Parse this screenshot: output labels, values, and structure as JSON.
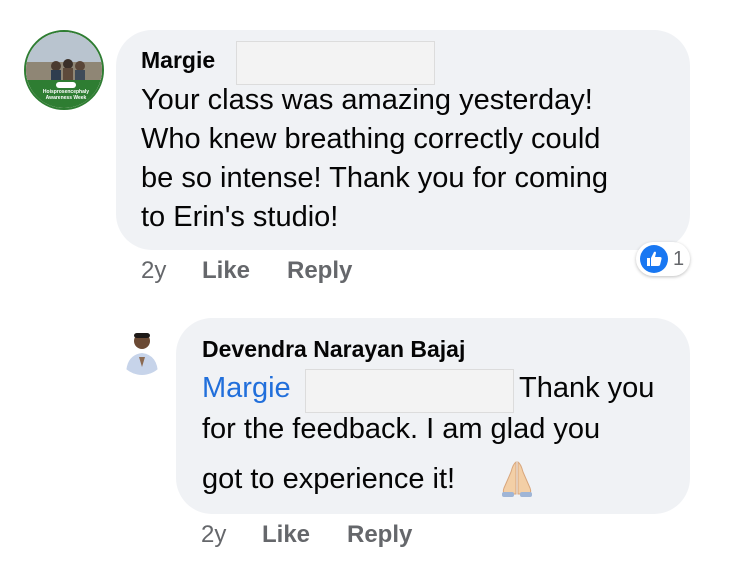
{
  "colors": {
    "bubble": "#f0f2f5",
    "name_link": "#216fdb",
    "meta": "#65676b",
    "like_blue": "#1877f2"
  },
  "comment": {
    "author": "Margie",
    "avatar_caption": "Hoisprosencephaly Awareness Week",
    "lines": [
      "Your class was amazing yesterday!",
      "Who knew breathing correctly could",
      "be so intense! Thank you for coming",
      "to Erin's studio!"
    ],
    "time": "2y",
    "like_label": "Like",
    "reply_label": "Reply",
    "reaction_icon": "thumbs-up-icon",
    "reaction_count": "1"
  },
  "reply": {
    "author": "Devendra Narayan Bajaj",
    "mention": "Margie",
    "line1_tail": "Thank you",
    "line2": "for the feedback. I am glad you",
    "line3": "got to experience it!",
    "emoji_icon": "praying-hands-icon",
    "time": "2y",
    "like_label": "Like",
    "reply_label": "Reply"
  }
}
